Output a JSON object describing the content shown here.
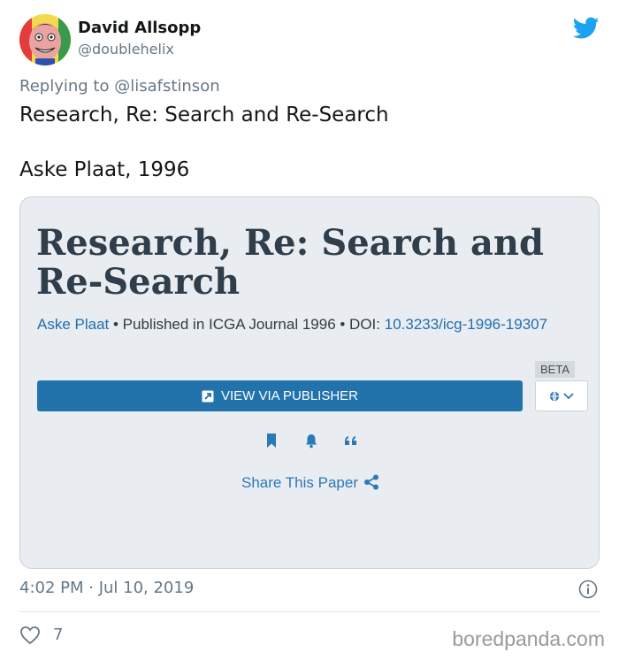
{
  "author": {
    "name": "David Allsopp",
    "handle": "@doublehelix"
  },
  "reply": {
    "prefix": "Replying to",
    "handle": "@lisafstinson"
  },
  "tweet": {
    "line1": "Research, Re: Search and Re-Search",
    "line2": "Aske Plaat, 1996"
  },
  "card": {
    "title": "Research, Re: Search and Re-Search",
    "author_link": "Aske Plaat",
    "sep1": " • Published in ICGA Journal 1996 • DOI: ",
    "doi_link": "10.3233/icg-1996-19307",
    "beta_label": "BETA",
    "publisher_button": "VIEW VIA PUBLISHER",
    "share_label": "Share This Paper"
  },
  "footer": {
    "timestamp": "4:02 PM · Jul 10, 2019",
    "likes": "7",
    "watermark": "boredpanda.com"
  },
  "colors": {
    "twitter_blue": "#1da1f2",
    "button_blue": "#2272ac",
    "link_blue": "#1f6fb0",
    "muted": "#657786"
  },
  "icons": [
    "twitter-bird-icon",
    "external-link-icon",
    "globe-icon",
    "chevron-down-icon",
    "bookmark-icon",
    "bell-icon",
    "quote-icon",
    "share-icon",
    "info-icon",
    "heart-icon"
  ]
}
